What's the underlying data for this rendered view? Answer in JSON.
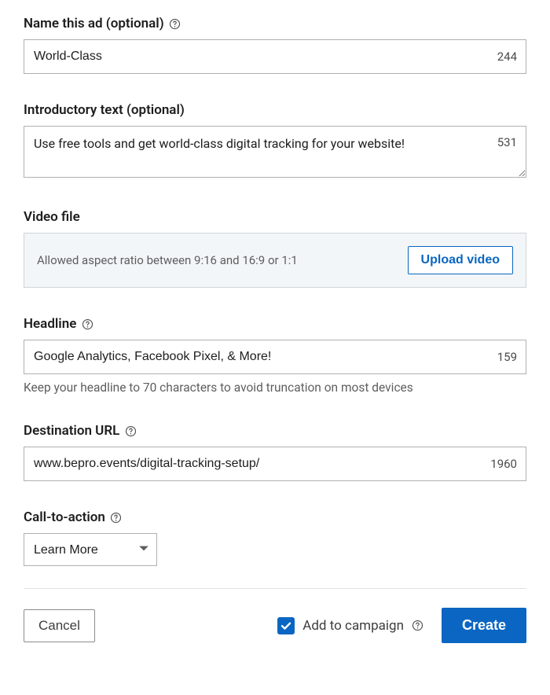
{
  "name_field": {
    "label": "Name this ad (optional)",
    "value": "World-Class",
    "counter": "244"
  },
  "intro_field": {
    "label": "Introductory text (optional)",
    "value": "Use free tools and get world-class digital tracking for your website!",
    "counter": "531"
  },
  "video_field": {
    "label": "Video file",
    "hint": "Allowed aspect ratio between 9:16 and 16:9 or 1:1",
    "button": "Upload video"
  },
  "headline_field": {
    "label": "Headline",
    "value": "Google Analytics, Facebook Pixel, & More!",
    "counter": "159",
    "helper": "Keep your headline to 70 characters to avoid truncation on most devices"
  },
  "url_field": {
    "label": "Destination URL",
    "value": "www.bepro.events/digital-tracking-setup/",
    "counter": "1960"
  },
  "cta_field": {
    "label": "Call-to-action",
    "selected": "Learn More"
  },
  "footer": {
    "cancel": "Cancel",
    "add_to_campaign": "Add to campaign",
    "create": "Create"
  }
}
